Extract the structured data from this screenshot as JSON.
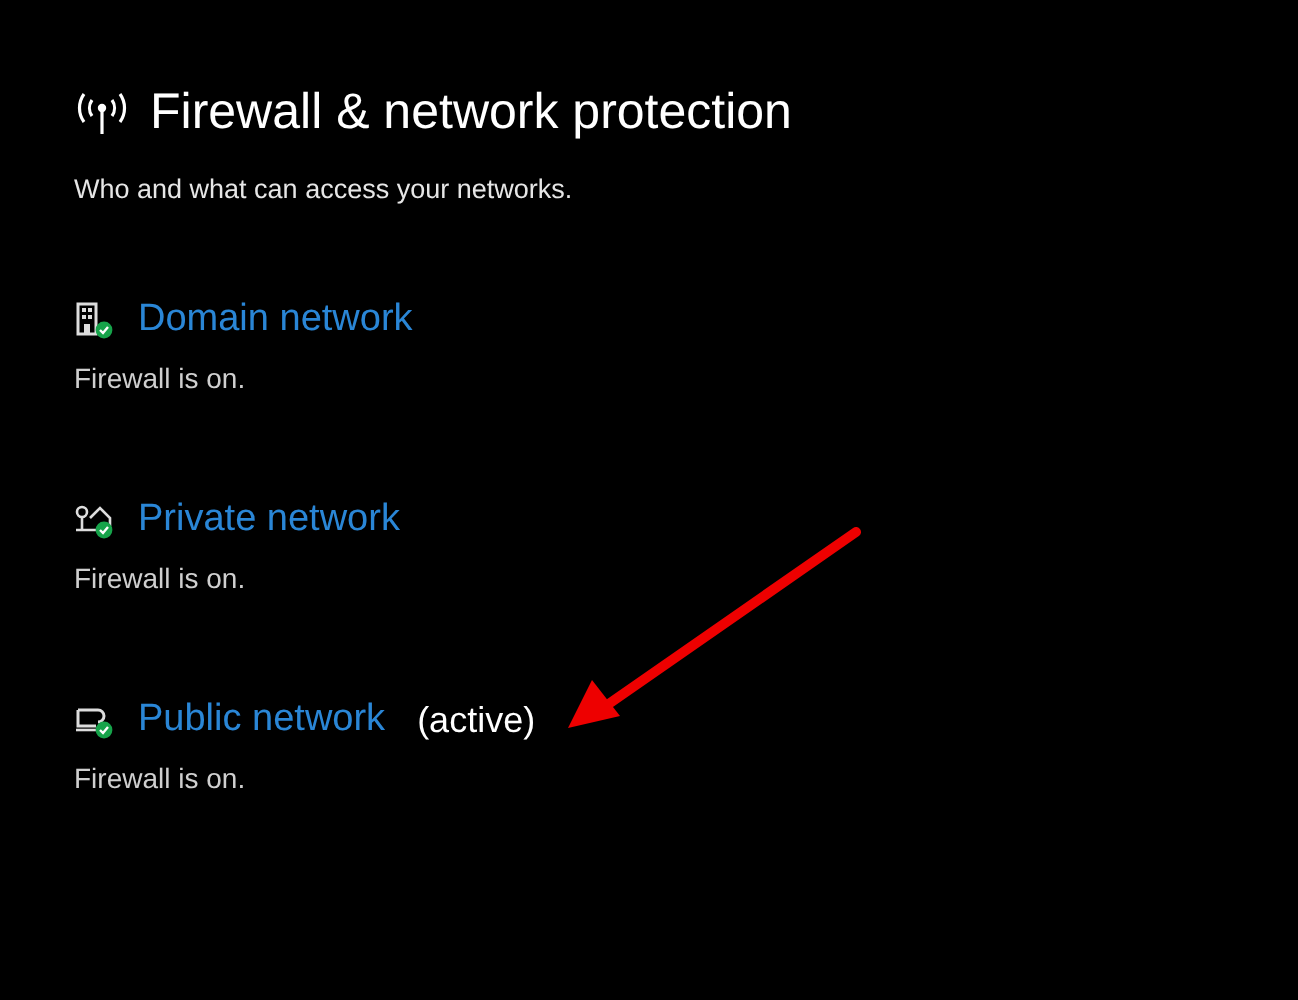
{
  "header": {
    "title": "Firewall & network protection",
    "subtitle": "Who and what can access your networks."
  },
  "networks": [
    {
      "kind": "domain",
      "name": "Domain network",
      "status": "Firewall is on."
    },
    {
      "kind": "private",
      "name": "Private network",
      "status": "Firewall is on."
    },
    {
      "kind": "public",
      "name": "Public network",
      "badge": "(active)",
      "status": "Firewall is on."
    }
  ]
}
